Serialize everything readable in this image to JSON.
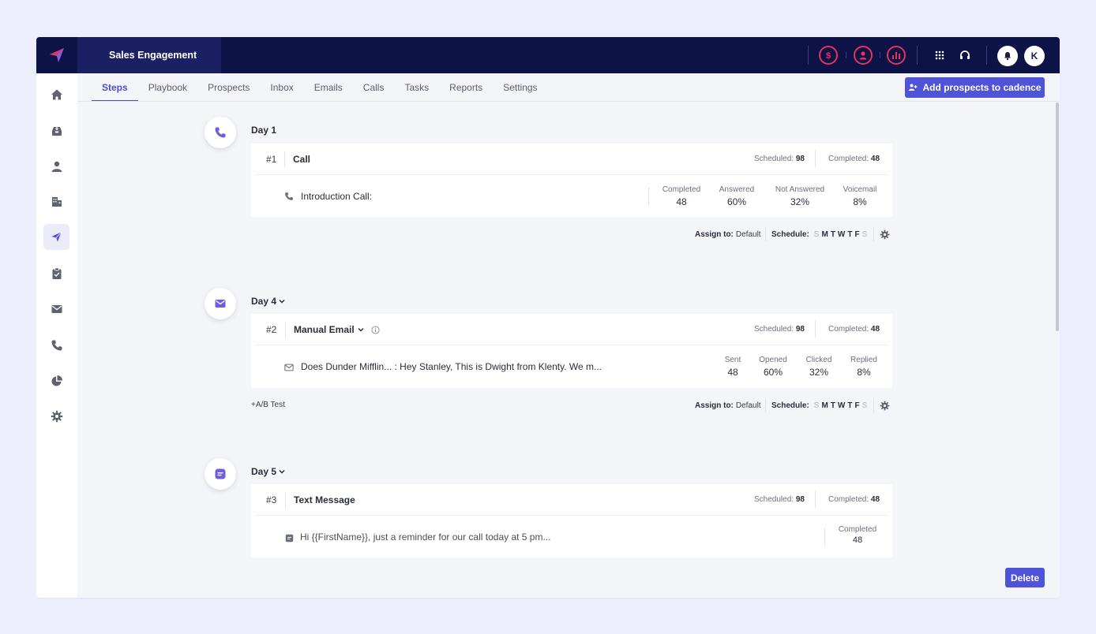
{
  "header": {
    "app_title": "Sales Engagement",
    "avatar_initial": "K",
    "brand_color": "#0d1247",
    "accent_color": "#e8325a",
    "icons": [
      "logo-icon",
      "dollar-icon",
      "user-icon",
      "chart-icon",
      "apps-grid-icon",
      "headset-icon",
      "bell-icon"
    ]
  },
  "sidebar": {
    "items": [
      {
        "name": "home",
        "icon": "home-icon"
      },
      {
        "name": "inbox",
        "icon": "inbox-icon"
      },
      {
        "name": "prospects",
        "icon": "person-icon"
      },
      {
        "name": "accounts",
        "icon": "building-icon"
      },
      {
        "name": "cadences",
        "icon": "send-icon",
        "active": true
      },
      {
        "name": "tasks",
        "icon": "clipboard-icon"
      },
      {
        "name": "emails",
        "icon": "mail-icon"
      },
      {
        "name": "calls",
        "icon": "phone-icon"
      },
      {
        "name": "reports",
        "icon": "pie-chart-icon"
      },
      {
        "name": "settings",
        "icon": "gear-icon"
      }
    ]
  },
  "tabs": [
    {
      "label": "Steps",
      "active": true
    },
    {
      "label": "Playbook"
    },
    {
      "label": "Prospects"
    },
    {
      "label": "Inbox"
    },
    {
      "label": "Emails"
    },
    {
      "label": "Calls"
    },
    {
      "label": "Tasks"
    },
    {
      "label": "Reports"
    },
    {
      "label": "Settings"
    }
  ],
  "add_prospects_label": "Add prospects to cadence",
  "steps": [
    {
      "day": "Day 1",
      "number": "#1",
      "title": "Call",
      "scheduled_label": "Scheduled:",
      "scheduled": "98",
      "completed_label": "Completed:",
      "completed": "48",
      "body": "Introduction Call:",
      "stats": [
        {
          "label": "Completed",
          "value": "48"
        },
        {
          "label": "Answered",
          "value": "60%"
        },
        {
          "label": "Not Answered",
          "value": "32%"
        },
        {
          "label": "Voicemail",
          "value": "8%"
        }
      ],
      "assign_label": "Assign to:",
      "assign_value": "Default",
      "schedule_label": "Schedule:"
    },
    {
      "day": "Day 4",
      "number": "#2",
      "title": "Manual Email",
      "scheduled_label": "Scheduled:",
      "scheduled": "98",
      "completed_label": "Completed:",
      "completed": "48",
      "body": "Does Dunder Mifflin... : Hey Stanley,   This is Dwight from Klenty. We m...",
      "stats": [
        {
          "label": "Sent",
          "value": "48"
        },
        {
          "label": "Opened",
          "value": "60%"
        },
        {
          "label": "Clicked",
          "value": "32%"
        },
        {
          "label": "Replied",
          "value": "8%"
        }
      ],
      "ab_test_label": "+A/B Test",
      "assign_label": "Assign to:",
      "assign_value": "Default",
      "schedule_label": "Schedule:"
    },
    {
      "day": "Day 5",
      "number": "#3",
      "title": "Text Message",
      "scheduled_label": "Scheduled:",
      "scheduled": "98",
      "completed_label": "Completed:",
      "completed": "48",
      "body": "Hi {{FirstName}}, just a reminder for our call today at 5 pm...",
      "stats": [
        {
          "label": "Completed",
          "value": "48"
        }
      ]
    }
  ],
  "schedule_days": [
    {
      "d": "S",
      "on": false
    },
    {
      "d": "M",
      "on": true
    },
    {
      "d": "T",
      "on": true
    },
    {
      "d": "W",
      "on": true
    },
    {
      "d": "T",
      "on": true
    },
    {
      "d": "F",
      "on": true
    },
    {
      "d": "S",
      "on": false
    }
  ],
  "delete_label": "Delete"
}
